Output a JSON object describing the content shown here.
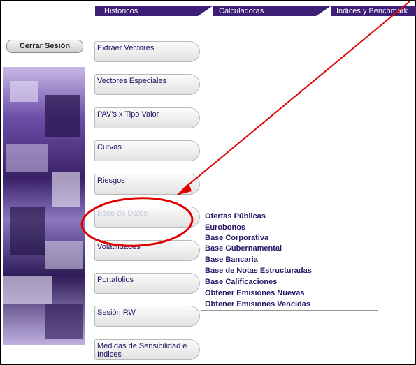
{
  "nav": {
    "tabs": [
      {
        "label": "Historicos"
      },
      {
        "label": "Calculadoras"
      },
      {
        "label": "Indices y Benchmark"
      }
    ]
  },
  "logout_label": "Cerrar Sesión",
  "menu": [
    {
      "label": "Extraer Vectores"
    },
    {
      "label": "Vectores Especiales"
    },
    {
      "label": "PAV's x Tipo Valor"
    },
    {
      "label": "Curvas"
    },
    {
      "label": "Riesgos"
    },
    {
      "label": "Base de Datos"
    },
    {
      "label": "Volatilidades"
    },
    {
      "label": "Portafolios"
    },
    {
      "label": "Sesión RW"
    },
    {
      "label": "Medidas de Sensibilidad e Indices"
    }
  ],
  "dropdown": [
    "Ofertas Públicas",
    "Eurobonos",
    "Base Corporativa",
    "Base Gubernamental",
    "Base Bancaria",
    "Base de Notas Estructuradas",
    "Base Calificaciones",
    "Obtener Emisiones Nuevas",
    "Obtener Emisiones Vencidas"
  ],
  "colors": {
    "nav_bg": "#3d1f78",
    "annotation": "#e00000",
    "menu_text": "#1a1060"
  }
}
